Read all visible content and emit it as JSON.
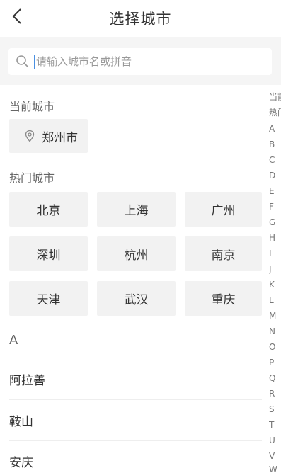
{
  "header": {
    "title": "选择城市",
    "back_icon": "chevron-left-icon"
  },
  "search": {
    "placeholder": "请输入城市名或拼音",
    "value": ""
  },
  "current_city": {
    "section_title": "当前城市",
    "city": "郑州市",
    "icon": "location-pin-icon"
  },
  "hot_cities": {
    "section_title": "热门城市",
    "cities": [
      "北京",
      "上海",
      "广州",
      "深圳",
      "杭州",
      "南京",
      "天津",
      "武汉",
      "重庆"
    ]
  },
  "city_list": {
    "letter": "A",
    "cities": [
      "阿拉善",
      "鞍山",
      "安庆"
    ]
  },
  "index_bar": {
    "items": [
      "当前",
      "热门",
      "A",
      "B",
      "C",
      "D",
      "E",
      "F",
      "G",
      "H",
      "I",
      "J",
      "K",
      "L",
      "M",
      "N",
      "O",
      "P",
      "Q",
      "R",
      "S",
      "T",
      "U",
      "V",
      "W"
    ]
  },
  "colors": {
    "background": "#ffffff",
    "chip": "#f2f2f2",
    "search_bg": "#f5f5f5",
    "text": "#333333",
    "muted": "#666666",
    "cursor": "#4a90e2"
  }
}
